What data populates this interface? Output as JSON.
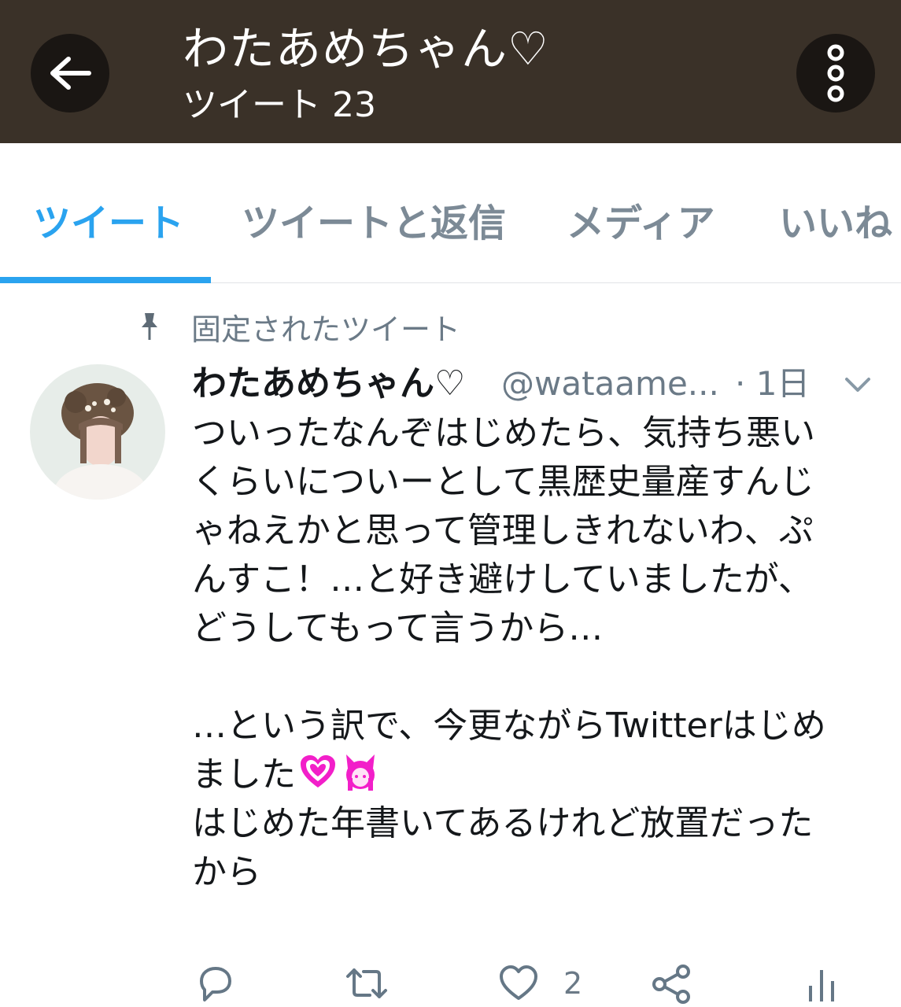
{
  "header": {
    "title": "わたあめちゃん♡",
    "subtitle": "ツイート 23",
    "back_icon": "arrow-left-icon",
    "more_icon": "more-vertical-icon",
    "background_color": "#3a3128"
  },
  "tabs": [
    {
      "label": "ツイート",
      "active": true
    },
    {
      "label": "ツイートと返信",
      "active": false
    },
    {
      "label": "メディア",
      "active": false
    },
    {
      "label": "いいね",
      "active": false
    }
  ],
  "accent_color": "#2aa3ef",
  "pinned": {
    "icon": "pin-icon",
    "label": "固定されたツイート"
  },
  "tweet": {
    "avatar_icon": "avatar",
    "display_name": "わたあめちゃん♡",
    "handle": "@wataame...",
    "time": "· 1日",
    "menu_icon": "chevron-down-icon",
    "lines": [
      "ついったなんぞはじめたら、気持ち悪い",
      "くらいについーとして黒歴史量産すんじ",
      "ゃねえかと思って管理しきれないわ、ぷ",
      "んすこ！…と好き避けしていましたが、",
      "どうしてもって言うから…",
      "…という訳で、今更ながらTwitterはじめ",
      "ました",
      "はじめた年書いてあるけれど放置だった",
      "から"
    ],
    "emojis": [
      "sparkling-heart-icon",
      "bunny-girl-icon"
    ],
    "actions": {
      "reply_icon": "reply-icon",
      "retweet_icon": "retweet-icon",
      "like_icon": "heart-icon",
      "like_count": "2",
      "share_icon": "share-icon",
      "analytics_icon": "analytics-icon"
    }
  }
}
